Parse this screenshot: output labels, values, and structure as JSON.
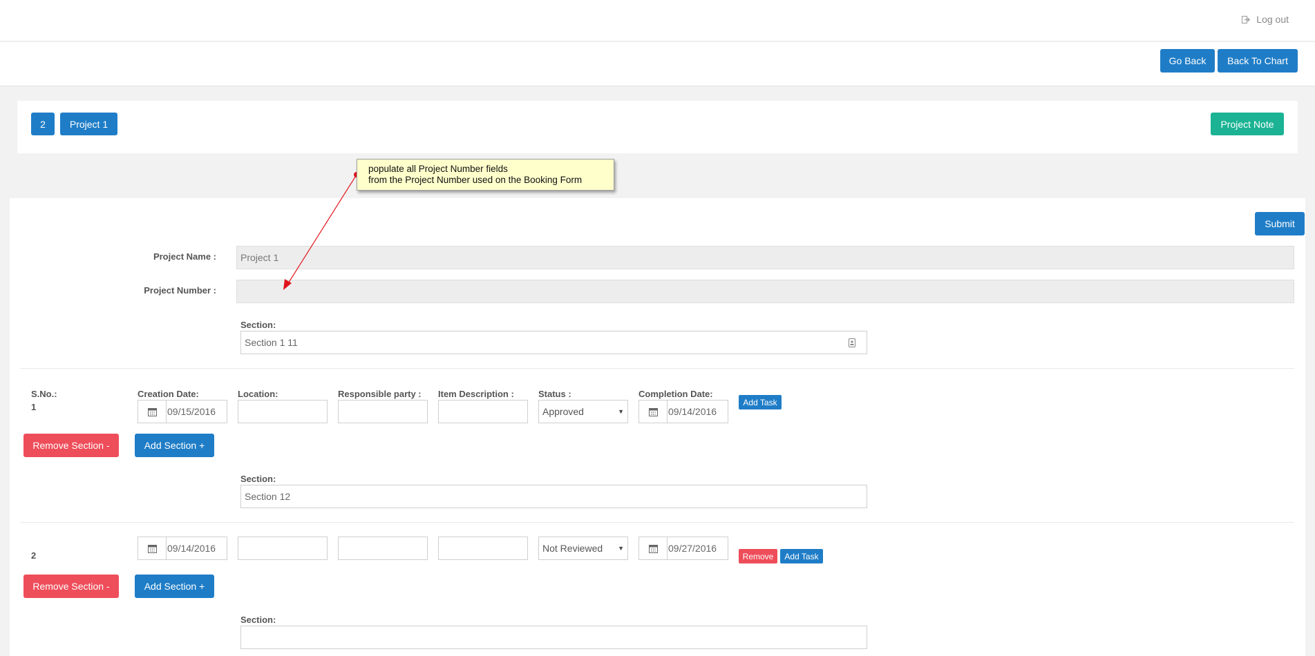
{
  "header": {
    "logout_label": "Log out"
  },
  "nav": {
    "go_back": "Go Back",
    "back_to_chart": "Back To Chart"
  },
  "project_bar": {
    "badge_number": "2",
    "project_button": "Project 1",
    "project_note": "Project Note"
  },
  "annotation": {
    "line1": "populate all Project Number fields",
    "line2": "from the Project Number used on the Booking Form"
  },
  "form": {
    "submit": "Submit",
    "project_name_label": "Project Name :",
    "project_name_value": "Project 1",
    "project_number_label": "Project Number :",
    "project_number_value": "",
    "section_label": "Section:",
    "columns": {
      "sno": "S.No.:",
      "creation_date": "Creation Date:",
      "location": "Location:",
      "responsible_party": "Responsible party :",
      "item_description": "Item Description :",
      "status": "Status :",
      "completion_date": "Completion Date:"
    },
    "sections": [
      {
        "section_value": "Section 1 11",
        "sno": "1",
        "creation_date": "09/15/2016",
        "location": "",
        "responsible_party": "",
        "item_description": "",
        "status": "Approved",
        "completion_date": "09/14/2016",
        "add_task": "Add Task",
        "remove_section": "Remove Section -",
        "add_section": "Add Section +"
      },
      {
        "section_value": "Section 12",
        "sno": "2",
        "creation_date": "09/14/2016",
        "location": "",
        "responsible_party": "",
        "item_description": "",
        "status": "Not Reviewed",
        "completion_date": "09/27/2016",
        "remove": "Remove",
        "add_task": "Add Task",
        "remove_section": "Remove Section -",
        "add_section": "Add Section +"
      },
      {
        "section_value": ""
      }
    ]
  },
  "colors": {
    "primary": "#1f7dc7",
    "success": "#1bb394",
    "danger": "#ee4d5a",
    "note_bg": "#ffffcc",
    "arrow": "#e0141e"
  }
}
